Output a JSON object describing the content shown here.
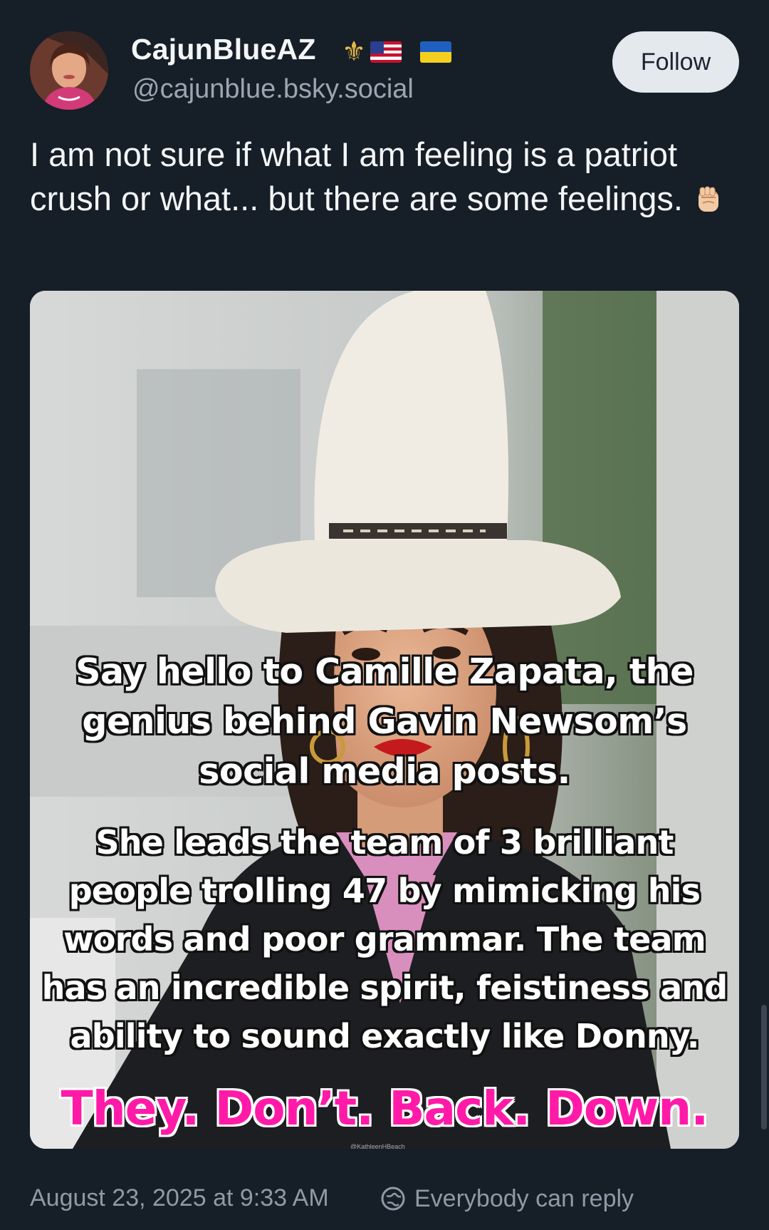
{
  "author": {
    "display_name": "CajunBlueAZ",
    "handle": "@cajunblue.bsky.social",
    "badges": [
      "fleur-de-lis-icon",
      "us-flag-icon",
      "ukraine-flag-icon"
    ]
  },
  "follow_label": "Follow",
  "post": {
    "text": "I am not sure if what I am feeling is a patriot crush or what... but there are some feelings.",
    "emoji": "raised-fist-icon"
  },
  "image": {
    "caption_1": "Say hello to Camille Zapata, the genius behind Gavin Newsom’s social media posts.",
    "caption_2": "She leads the team of 3 brilliant people trolling 47 by mimicking his words and poor grammar. The team has an incredible spirit, feistiness and ability to sound exactly like Donny.",
    "caption_3": "They. Don’t. Back. Down.",
    "watermark": "@KathleenHBeach"
  },
  "footer": {
    "timestamp": "August 23, 2025 at 9:33 AM",
    "reply_setting": "Everybody can reply"
  },
  "colors": {
    "background": "#161e27",
    "accent_pink": "#ff1aa8",
    "muted_text": "#8e9aa6"
  }
}
